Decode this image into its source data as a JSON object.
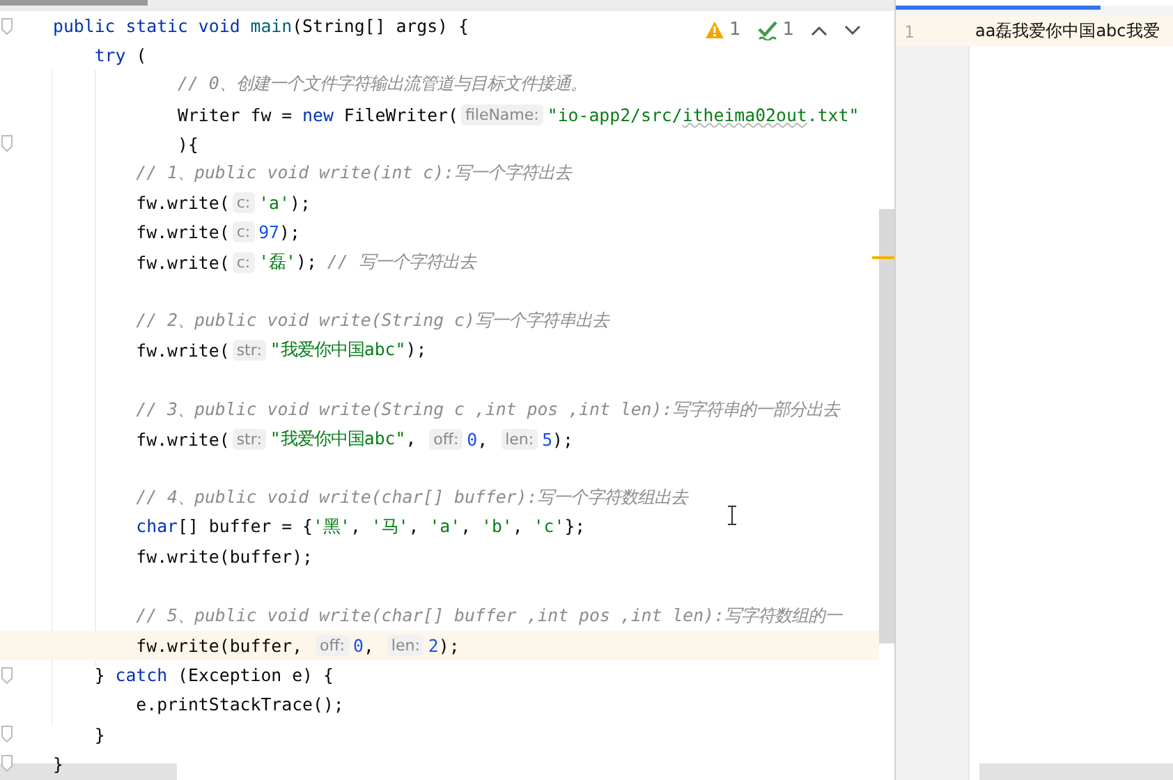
{
  "editor": {
    "inspections": [
      {
        "kind": "warning",
        "count": "1"
      },
      {
        "kind": "typo",
        "count": "1"
      }
    ],
    "lines": [
      {
        "fold": true,
        "current": false,
        "tokens": [
          {
            "kind": "kw",
            "text": "public static void "
          },
          {
            "kind": "decl",
            "text": "main"
          },
          {
            "kind": "plain",
            "text": "(String[] args) {"
          }
        ]
      },
      {
        "fold": false,
        "current": false,
        "tokens": [
          {
            "kind": "kw",
            "text": "    try "
          },
          {
            "kind": "plain",
            "text": "("
          }
        ]
      },
      {
        "fold": false,
        "current": false,
        "tokens": [
          {
            "kind": "comment",
            "text": "            // 0、创建一个文件字符输出流管道与目标文件接通。"
          }
        ]
      },
      {
        "fold": false,
        "current": false,
        "tokens": [
          {
            "kind": "plain",
            "text": "            Writer fw = "
          },
          {
            "kind": "kw",
            "text": "new "
          },
          {
            "kind": "plain",
            "text": "FileWriter("
          },
          {
            "kind": "hint",
            "text": "fileName:"
          },
          {
            "kind": "str",
            "text": "\"io-app2/src/"
          },
          {
            "kind": "str",
            "text": "itheima02out",
            "typo": true
          },
          {
            "kind": "str",
            "text": ".txt\""
          }
        ]
      },
      {
        "fold": true,
        "current": false,
        "tokens": [
          {
            "kind": "plain",
            "text": "            ){"
          }
        ]
      },
      {
        "fold": false,
        "current": false,
        "tokens": [
          {
            "kind": "comment",
            "text": "        // 1、public void write(int c):写一个字符出去"
          }
        ]
      },
      {
        "fold": false,
        "current": false,
        "tokens": [
          {
            "kind": "plain",
            "text": "        fw.write("
          },
          {
            "kind": "hint",
            "text": "c:"
          },
          {
            "kind": "str",
            "text": "'a'"
          },
          {
            "kind": "plain",
            "text": ");"
          }
        ]
      },
      {
        "fold": false,
        "current": false,
        "tokens": [
          {
            "kind": "plain",
            "text": "        fw.write("
          },
          {
            "kind": "hint",
            "text": "c:"
          },
          {
            "kind": "num",
            "text": "97"
          },
          {
            "kind": "plain",
            "text": ");"
          }
        ]
      },
      {
        "fold": false,
        "current": false,
        "tokens": [
          {
            "kind": "plain",
            "text": "        fw.write("
          },
          {
            "kind": "hint",
            "text": "c:"
          },
          {
            "kind": "str",
            "text": "'磊'"
          },
          {
            "kind": "plain",
            "text": "); "
          },
          {
            "kind": "comment",
            "text": "// 写一个字符出去"
          }
        ]
      },
      {
        "fold": false,
        "current": false
      },
      {
        "fold": false,
        "current": false,
        "tokens": [
          {
            "kind": "comment",
            "text": "        // 2、public void write(String c)写一个字符串出去"
          }
        ]
      },
      {
        "fold": false,
        "current": false,
        "tokens": [
          {
            "kind": "plain",
            "text": "        fw.write("
          },
          {
            "kind": "hint",
            "text": "str:"
          },
          {
            "kind": "str",
            "text": "\"我爱你中国abc\""
          },
          {
            "kind": "plain",
            "text": ");"
          }
        ]
      },
      {
        "fold": false,
        "current": false
      },
      {
        "fold": false,
        "current": false,
        "tokens": [
          {
            "kind": "comment",
            "text": "        // 3、public void write(String c ,int pos ,int len):写字符串的一部分出去"
          }
        ]
      },
      {
        "fold": false,
        "current": false,
        "tokens": [
          {
            "kind": "plain",
            "text": "        fw.write("
          },
          {
            "kind": "hint",
            "text": "str:"
          },
          {
            "kind": "str",
            "text": "\"我爱你中国abc\""
          },
          {
            "kind": "plain",
            "text": ", "
          },
          {
            "kind": "hint",
            "text": "off:"
          },
          {
            "kind": "num",
            "text": "0"
          },
          {
            "kind": "plain",
            "text": ", "
          },
          {
            "kind": "hint",
            "text": "len:"
          },
          {
            "kind": "num",
            "text": "5"
          },
          {
            "kind": "plain",
            "text": ");"
          }
        ]
      },
      {
        "fold": false,
        "current": false
      },
      {
        "fold": false,
        "current": false,
        "tokens": [
          {
            "kind": "comment",
            "text": "        // 4、public void write(char[] buffer):写一个字符数组出去"
          }
        ]
      },
      {
        "fold": false,
        "current": false,
        "tokens": [
          {
            "kind": "kw",
            "text": "        char"
          },
          {
            "kind": "plain",
            "text": "[] buffer = {"
          },
          {
            "kind": "str",
            "text": "'黑'"
          },
          {
            "kind": "plain",
            "text": ", "
          },
          {
            "kind": "str",
            "text": "'马'"
          },
          {
            "kind": "plain",
            "text": ", "
          },
          {
            "kind": "str",
            "text": "'a'"
          },
          {
            "kind": "plain",
            "text": ", "
          },
          {
            "kind": "str",
            "text": "'b'"
          },
          {
            "kind": "plain",
            "text": ", "
          },
          {
            "kind": "str",
            "text": "'c'"
          },
          {
            "kind": "plain",
            "text": "};"
          }
        ]
      },
      {
        "fold": false,
        "current": false,
        "tokens": [
          {
            "kind": "plain",
            "text": "        fw.write(buffer);"
          }
        ]
      },
      {
        "fold": false,
        "current": false
      },
      {
        "fold": false,
        "current": false,
        "tokens": [
          {
            "kind": "comment",
            "text": "        // 5、public void write(char[] buffer ,int pos ,int len):写字符数组的一"
          }
        ]
      },
      {
        "fold": false,
        "current": true,
        "tokens": [
          {
            "kind": "plain",
            "text": "        fw.write(buffer, "
          },
          {
            "kind": "hint",
            "text": "off:"
          },
          {
            "kind": "num",
            "text": "0"
          },
          {
            "kind": "plain",
            "text": ", "
          },
          {
            "kind": "hint",
            "text": "len:"
          },
          {
            "kind": "num",
            "text": "2"
          },
          {
            "kind": "plain",
            "text": ");"
          }
        ]
      },
      {
        "fold": true,
        "current": false,
        "tokens": [
          {
            "kind": "plain",
            "text": "    } "
          },
          {
            "kind": "kw",
            "text": "catch "
          },
          {
            "kind": "plain",
            "text": "(Exception e) {"
          }
        ]
      },
      {
        "fold": false,
        "current": false,
        "tokens": [
          {
            "kind": "plain",
            "text": "        e.printStackTrace();"
          }
        ]
      },
      {
        "fold": true,
        "current": false,
        "tokens": [
          {
            "kind": "plain",
            "text": "    }"
          }
        ]
      },
      {
        "fold": true,
        "current": false,
        "tokens": [
          {
            "kind": "plain",
            "text": "}"
          }
        ]
      }
    ]
  },
  "output_file": {
    "lines": [
      {
        "number": "1",
        "text": "aa磊我爱你中国abc我爱",
        "current": true
      }
    ]
  }
}
